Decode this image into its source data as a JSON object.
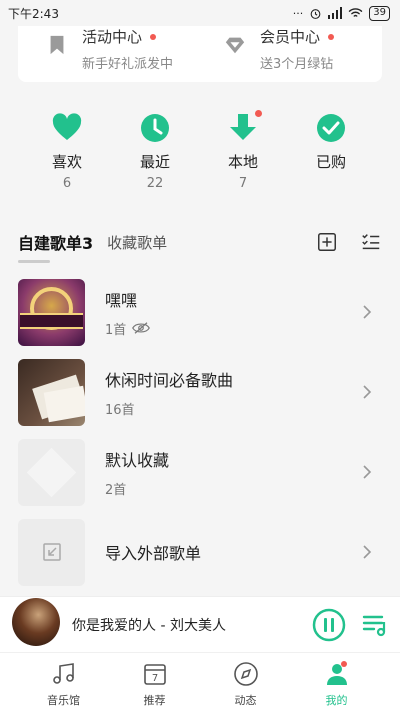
{
  "status_bar": {
    "time": "下午2:43",
    "battery": "39"
  },
  "promo": [
    {
      "title": "活动中心",
      "subtitle": "新手好礼派发中",
      "icon": "bookmark-icon"
    },
    {
      "title": "会员中心",
      "subtitle": "送3个月绿钻",
      "icon": "diamond-icon"
    }
  ],
  "quick": [
    {
      "label": "喜欢",
      "count": "6",
      "icon": "heart-icon"
    },
    {
      "label": "最近",
      "count": "22",
      "icon": "clock-icon"
    },
    {
      "label": "本地",
      "count": "7",
      "icon": "download-icon"
    },
    {
      "label": "已购",
      "count": "",
      "icon": "check-circle-icon"
    }
  ],
  "tabs": {
    "active": "自建歌单3",
    "inactive": "收藏歌单"
  },
  "playlists": [
    {
      "title": "嘿嘿",
      "subtitle": "1首"
    },
    {
      "title": "休闲时间必备歌曲",
      "subtitle": "16首"
    },
    {
      "title": "默认收藏",
      "subtitle": "2首"
    },
    {
      "title": "导入外部歌单",
      "subtitle": ""
    }
  ],
  "player": {
    "title": "你是我爱的人 - 刘大美人"
  },
  "nav": [
    {
      "label": "音乐馆",
      "icon": "music-note-icon"
    },
    {
      "label": "推荐",
      "icon": "calendar-icon",
      "icon_text": "7"
    },
    {
      "label": "动态",
      "icon": "compass-icon"
    },
    {
      "label": "我的",
      "icon": "profile-icon"
    }
  ],
  "colors": {
    "accent": "#22c18d",
    "badge": "#f25a52"
  }
}
